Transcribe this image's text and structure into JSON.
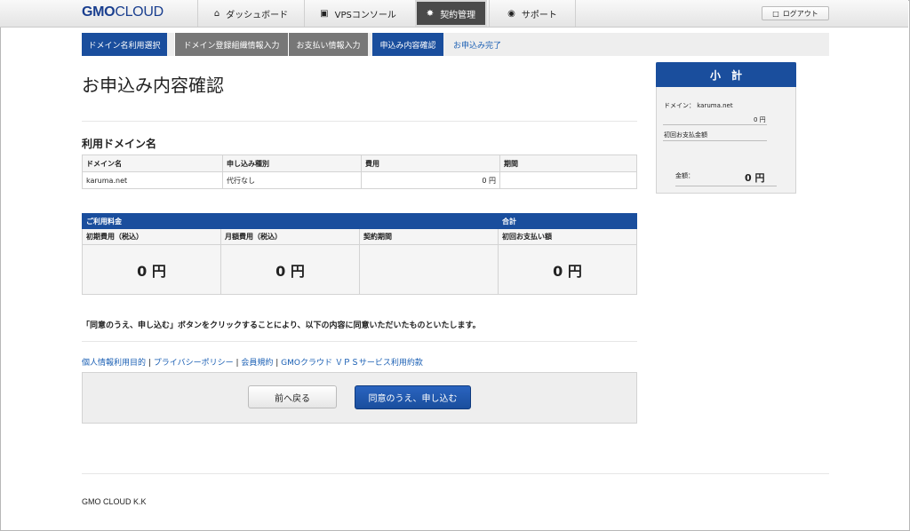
{
  "header": {
    "logo_gmo": "GMO",
    "logo_cloud": "CLOUD",
    "tabs": [
      {
        "label": "ダッシュボード",
        "icon": "home-icon"
      },
      {
        "label": "VPSコンソール",
        "icon": "console-icon"
      },
      {
        "label": "契約管理",
        "icon": "gear-icon"
      },
      {
        "label": "サポート",
        "icon": "camera-icon"
      }
    ],
    "logout_label": "ログアウト"
  },
  "steps": [
    {
      "label": "ドメイン名利用選択"
    },
    {
      "label": "ドメイン登録組織情報入力"
    },
    {
      "label": "お支払い情報入力"
    },
    {
      "label": "申込み内容確認"
    },
    {
      "label": "お申込み完了"
    }
  ],
  "page_title": "お申込み内容確認",
  "domain_section": {
    "title": "利用ドメイン名",
    "headers": [
      "ドメイン名",
      "申し込み種別",
      "費用",
      "期間"
    ],
    "row": {
      "domain": "karuma.net",
      "type": "代行なし",
      "fee": "0 円",
      "period": ""
    }
  },
  "fee_section": {
    "bar_left": "ご利用料金",
    "bar_right": "合計",
    "headers": [
      "初期費用（税込）",
      "月額費用（税込）",
      "契約期間",
      "初回お支払い額"
    ],
    "values": [
      "0 円",
      "0 円",
      "",
      "0 円"
    ]
  },
  "notice": "「同意のうえ、申し込む」ボタンをクリックすることにより、以下の内容に同意いただいたものといたします。",
  "links": [
    "個人情報利用目的",
    "プライバシーポリシー",
    "会員規約",
    "GMOクラウド ＶＰＳサービス利用約款"
  ],
  "link_separator": " | ",
  "buttons": {
    "back": "前へ戻る",
    "agree": "同意のうえ、申し込む"
  },
  "footer": "GMO CLOUD K.K",
  "subtotal": {
    "title": "小　計",
    "domain_label": "ドメイン：",
    "domain_value": "karuma.net",
    "domain_fee": "0 円",
    "first_payment_label": "初回お支払金額",
    "amount_label": "金額：",
    "amount_value": "0 円"
  },
  "colors": {
    "brand_blue": "#1a4e9d",
    "link_blue": "#1a5fb4",
    "step_gray": "#777777"
  }
}
